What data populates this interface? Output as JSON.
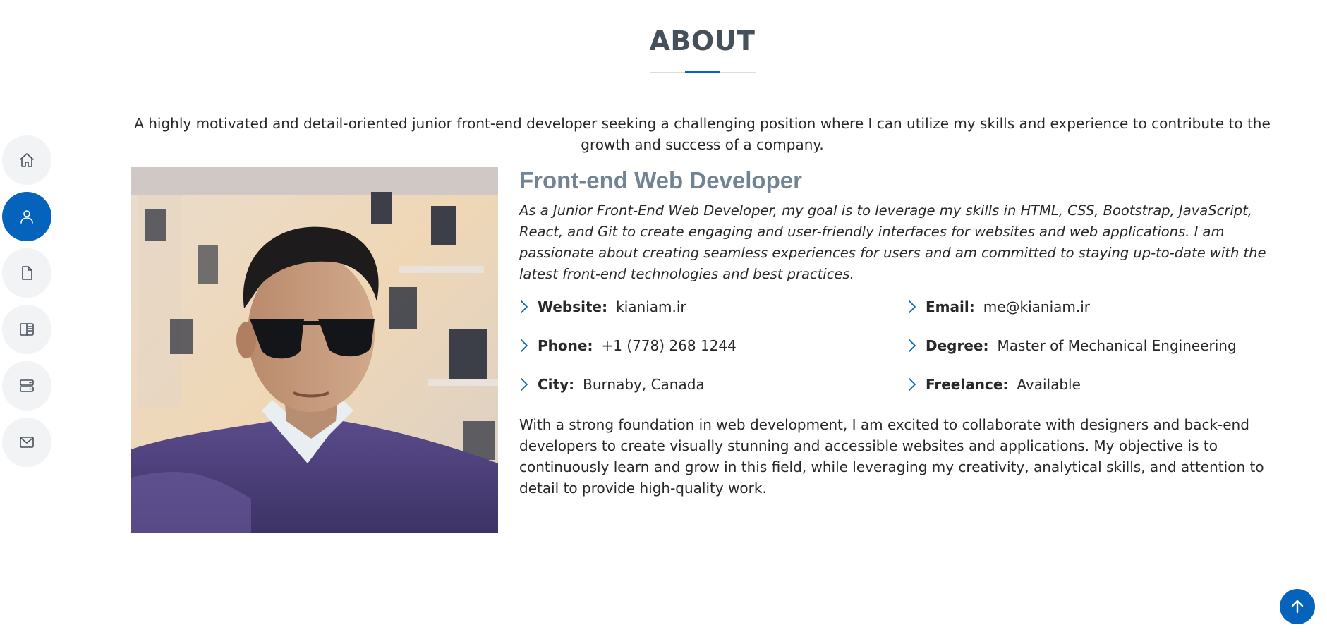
{
  "nav": {
    "items": [
      {
        "icon": "home-icon",
        "active": false
      },
      {
        "icon": "person-icon",
        "active": true
      },
      {
        "icon": "file-icon",
        "active": false
      },
      {
        "icon": "book-icon",
        "active": false
      },
      {
        "icon": "server-icon",
        "active": false
      },
      {
        "icon": "envelope-icon",
        "active": false
      }
    ]
  },
  "about": {
    "title": "ABOUT",
    "intro": "A highly motivated and detail-oriented junior front-end developer seeking a challenging position where I can utilize my skills and experience to contribute to the growth and success of a company.",
    "heading": "Front-end Web Developer",
    "lead": "As a Junior Front-End Web Developer, my goal is to leverage my skills in HTML, CSS, Bootstrap, JavaScript, React, and Git to create engaging and user-friendly interfaces for websites and web applications. I am passionate about creating seamless experiences for users and am committed to staying up-to-date with the latest front-end technologies and best practices.",
    "facts": [
      {
        "label": "Website:",
        "value": "kianiam.ir"
      },
      {
        "label": "Email:",
        "value": "me@kianiam.ir"
      },
      {
        "label": "Phone:",
        "value": "+1 (778) 268 1244"
      },
      {
        "label": "Degree:",
        "value": "Master of Mechanical Engineering"
      },
      {
        "label": "City:",
        "value": "Burnaby, Canada"
      },
      {
        "label": "Freelance:",
        "value": "Available"
      }
    ],
    "closing": "With a strong foundation in web development, I am excited to collaborate with designers and back-end developers to create visually stunning and accessible websites and applications. My objective is to continuously learn and grow in this field, while leveraging my creativity, analytical skills, and attention to detail to provide high-quality work."
  },
  "colors": {
    "accent": "#0563bb",
    "heading": "#45505b",
    "subheading": "#728394"
  },
  "back_to_top": {
    "icon": "arrow-up-icon"
  }
}
